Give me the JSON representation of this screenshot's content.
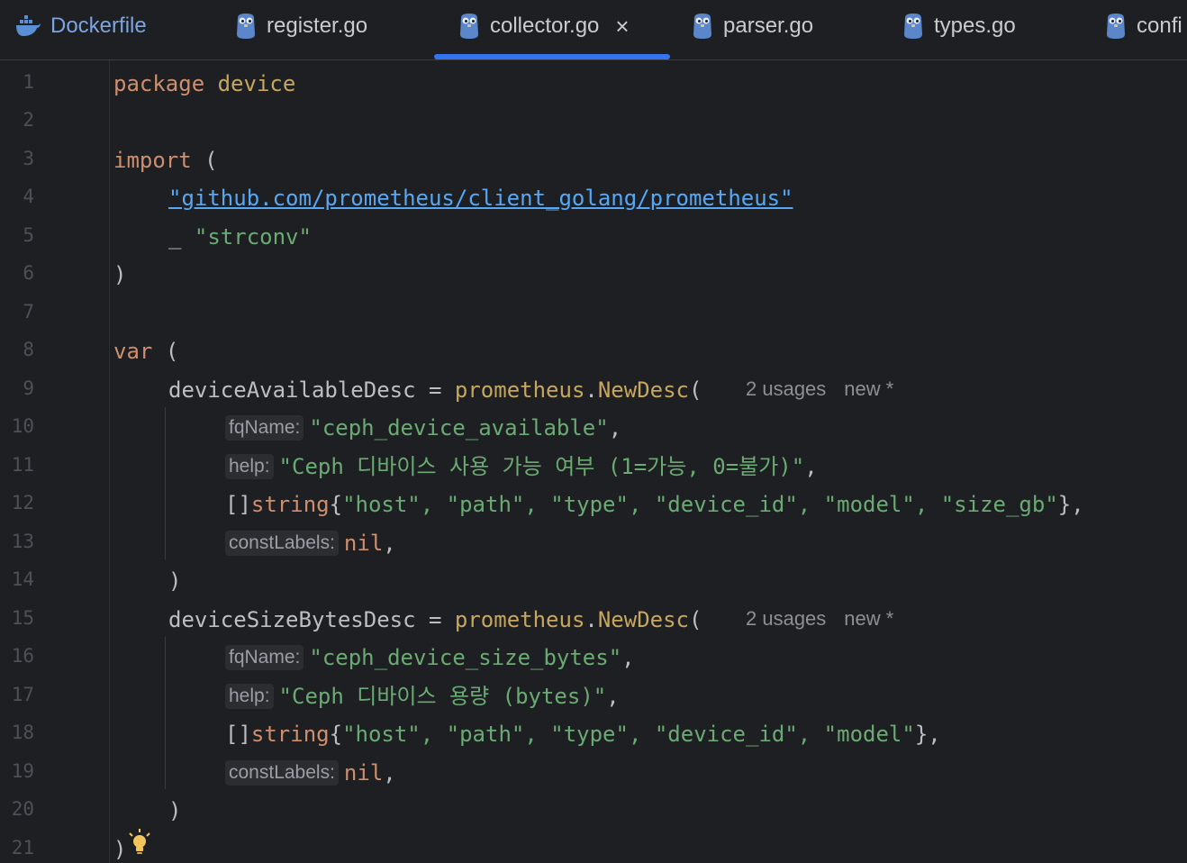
{
  "tabs": [
    {
      "label": "Dockerfile",
      "icon": "docker-icon",
      "active": false
    },
    {
      "label": "register.go",
      "icon": "gopher-icon",
      "active": false
    },
    {
      "label": "collector.go",
      "icon": "gopher-icon",
      "active": true,
      "close_glyph": "×"
    },
    {
      "label": "parser.go",
      "icon": "gopher-icon",
      "active": false
    },
    {
      "label": "types.go",
      "icon": "gopher-icon",
      "active": false
    },
    {
      "label": "confi",
      "icon": "gopher-icon",
      "active": false
    }
  ],
  "line_numbers": [
    "1",
    "2",
    "3",
    "4",
    "5",
    "6",
    "7",
    "8",
    "9",
    "10",
    "11",
    "12",
    "13",
    "14",
    "15",
    "16",
    "17",
    "18",
    "19",
    "20",
    "21"
  ],
  "code": {
    "l1": {
      "kw": "package",
      "name": "device"
    },
    "l3": {
      "kw": "import",
      "paren": "("
    },
    "l4": {
      "path": "\"github.com/prometheus/client_golang/prometheus\""
    },
    "l5": {
      "blank": "_",
      "str": "\"strconv\""
    },
    "l6": {
      "paren": ")"
    },
    "l8": {
      "kw": "var",
      "paren": "("
    },
    "l9": {
      "var": "deviceAvailableDesc",
      "eq": " = ",
      "pkg": "prometheus",
      "dot": ".",
      "fn": "NewDesc",
      "paren": "("
    },
    "l9_meta": {
      "usages": "2 usages",
      "author": "new *"
    },
    "l10": {
      "hint": "fqName:",
      "str": "\"ceph_device_available\"",
      "tail": ","
    },
    "l11": {
      "hint": "help:",
      "str": "\"Ceph 디바이스 사용 가능 여부 (1=가능, 0=불가)\"",
      "tail": ","
    },
    "l12": {
      "brackets": "[]",
      "type": "string",
      "open": "{",
      "items": "\"host\", \"path\", \"type\", \"device_id\", \"model\", \"size_gb\"",
      "close": "},"
    },
    "l13": {
      "hint": "constLabels:",
      "nil": "nil",
      "tail": ","
    },
    "l14": {
      "paren": ")"
    },
    "l15": {
      "var": "deviceSizeBytesDesc",
      "eq": " = ",
      "pkg": "prometheus",
      "dot": ".",
      "fn": "NewDesc",
      "paren": "("
    },
    "l15_meta": {
      "usages": "2 usages",
      "author": "new *"
    },
    "l16": {
      "hint": "fqName:",
      "str": "\"ceph_device_size_bytes\"",
      "tail": ","
    },
    "l17": {
      "hint": "help:",
      "str": "\"Ceph 디바이스 용량 (bytes)\"",
      "tail": ","
    },
    "l18": {
      "brackets": "[]",
      "type": "string",
      "open": "{",
      "items": "\"host\", \"path\", \"type\", \"device_id\", \"model\"",
      "close": "},"
    },
    "l19": {
      "hint": "constLabels:",
      "nil": "nil",
      "tail": ","
    },
    "l20": {
      "paren": ")"
    },
    "l21": {
      "paren": ")"
    }
  },
  "icons": {
    "intention": "lightbulb-icon"
  },
  "colors": {
    "background": "#1e1f22",
    "keyword": "#cf8e6d",
    "string": "#6aab73",
    "function": "#56a8f5",
    "package": "#c7a65d",
    "active_tab_underline": "#3574f0"
  }
}
